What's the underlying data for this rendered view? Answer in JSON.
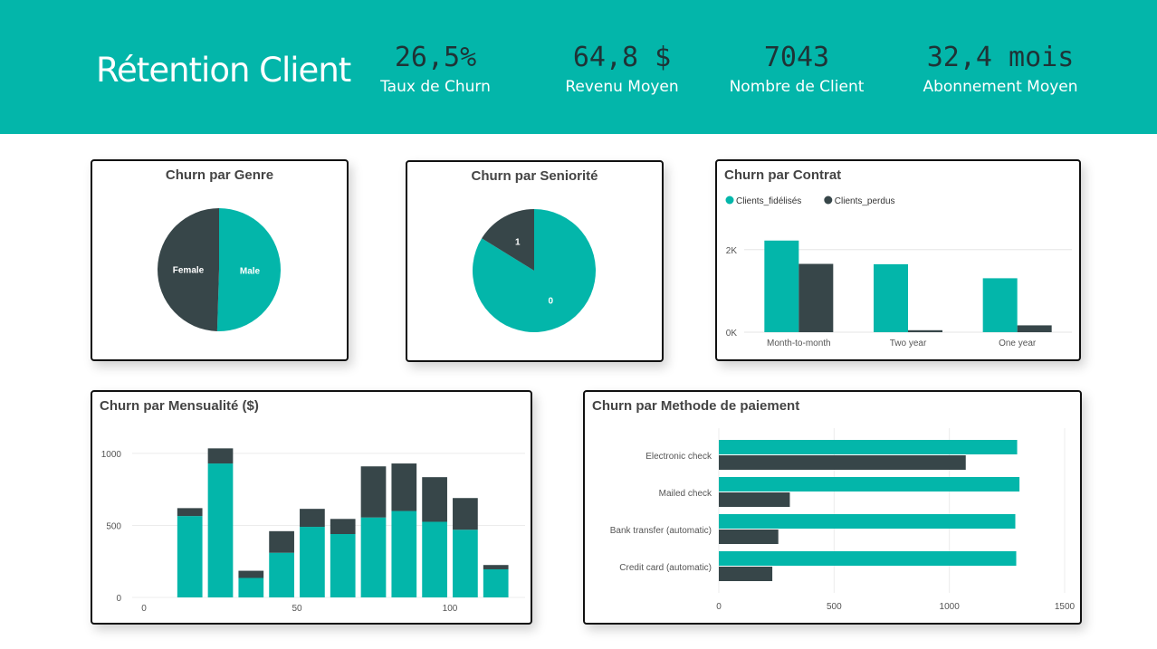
{
  "header": {
    "title": "Rétention Client",
    "kpis": [
      {
        "value": "26,5%",
        "label": "Taux de Churn"
      },
      {
        "value": "64,8 $",
        "label": "Revenu Moyen"
      },
      {
        "value": "7043",
        "label": "Nombre de Client"
      },
      {
        "value": "32,4 mois",
        "label": "Abonnement Moyen"
      }
    ]
  },
  "colors": {
    "header": "#03b6aa",
    "teal": "#03b6aa",
    "dark": "#374649"
  },
  "chart_data": [
    {
      "id": "genre",
      "type": "pie",
      "title": "Churn par Genre",
      "slices": [
        {
          "label": "Male",
          "value": 50.5,
          "color": "#03b6aa"
        },
        {
          "label": "Female",
          "value": 49.5,
          "color": "#374649"
        }
      ]
    },
    {
      "id": "seniorite",
      "type": "pie",
      "title": "Churn par Seniorité",
      "slices": [
        {
          "label": "0",
          "value": 83.8,
          "color": "#03b6aa"
        },
        {
          "label": "1",
          "value": 16.2,
          "color": "#374649"
        }
      ]
    },
    {
      "id": "contrat",
      "type": "bar",
      "title": "Churn par Contrat",
      "categories": [
        "Month-to-month",
        "Two year",
        "One year"
      ],
      "series": [
        {
          "name": "Clients_fidélisés",
          "values": [
            2220,
            1647,
            1307
          ],
          "color": "#03b6aa"
        },
        {
          "name": "Clients_perdus",
          "values": [
            1655,
            48,
            166
          ],
          "color": "#374649"
        }
      ],
      "ylim": [
        0,
        2500
      ],
      "yticks": [
        0,
        2000
      ],
      "ytick_labels": [
        "0K",
        "2K"
      ],
      "legend": "top-left"
    },
    {
      "id": "mensualite",
      "type": "bar",
      "title": "Churn par Mensualité ($)",
      "stacked": true,
      "x": [
        15,
        25,
        35,
        45,
        55,
        65,
        75,
        85,
        95,
        105,
        115
      ],
      "series": [
        {
          "name": "Clients_fidélisés",
          "values": [
            565,
            930,
            135,
            310,
            490,
            440,
            555,
            600,
            525,
            470,
            195
          ],
          "color": "#03b6aa"
        },
        {
          "name": "Clients_perdus",
          "values": [
            55,
            105,
            50,
            150,
            125,
            105,
            355,
            330,
            310,
            220,
            30
          ],
          "color": "#374649"
        }
      ],
      "xlim": [
        -5,
        125
      ],
      "xticks": [
        0,
        50,
        100
      ],
      "ylim": [
        0,
        1100
      ],
      "yticks": [
        0,
        500,
        1000
      ]
    },
    {
      "id": "paiement",
      "type": "bar",
      "orientation": "horizontal",
      "title": "Churn par Methode de paiement",
      "categories": [
        "Electronic check",
        "Mailed check",
        "Bank transfer (automatic)",
        "Credit card (automatic)"
      ],
      "series": [
        {
          "name": "Clients_fidélisés",
          "values": [
            1294,
            1304,
            1286,
            1290
          ],
          "color": "#03b6aa"
        },
        {
          "name": "Clients_perdus",
          "values": [
            1071,
            308,
            258,
            232
          ],
          "color": "#374649"
        }
      ],
      "xlim": [
        0,
        1500
      ],
      "xticks": [
        0,
        500,
        1000,
        1500
      ]
    }
  ]
}
